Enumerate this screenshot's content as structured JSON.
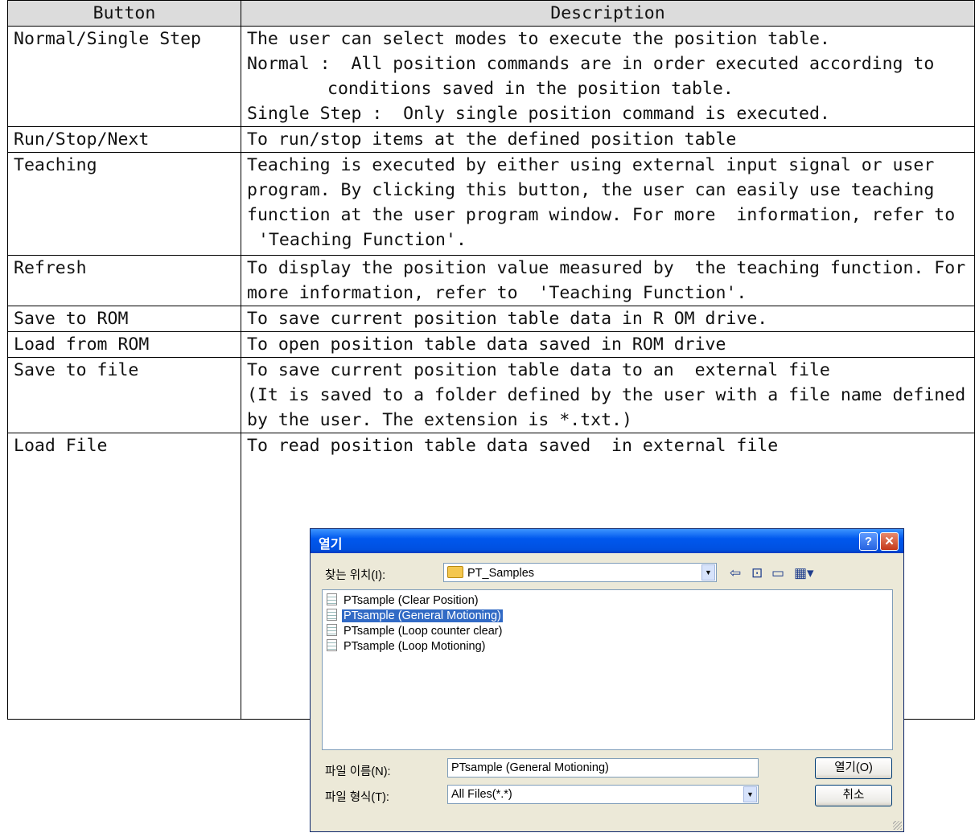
{
  "table": {
    "headers": [
      "Button",
      "Description"
    ],
    "rows": [
      {
        "button": "Normal/Single Step",
        "lines": [
          "The user can select modes to execute the position table.",
          "Normal :  All position commands are in order executed according to",
          "conditions saved in the position table.",
          "Single Step :  Only single position command is executed."
        ]
      },
      {
        "button": "Run/Stop/Next",
        "lines": [
          "To run/stop items at the defined position table"
        ]
      },
      {
        "button": "Teaching",
        "lines": [
          "Teaching is executed by either using external input signal or user",
          "program. By clicking this button, the user can easily use teaching",
          "function at the user program window. For more  information, refer to",
          "'Teaching Function'."
        ]
      },
      {
        "button": "Refresh",
        "lines": [
          "To display the position value measured by  the teaching function. For",
          "more information, refer to  'Teaching Function'."
        ]
      },
      {
        "button": "Save to ROM",
        "lines": [
          "To save current position table data in R OM drive."
        ]
      },
      {
        "button": "Load from ROM",
        "lines": [
          "To open position table data saved in ROM drive"
        ]
      },
      {
        "button": "Save to file",
        "lines": [
          "To save current position table data to an  external file",
          "(It is saved to a folder defined by the user with a file name defined",
          "by the user. The extension is *.txt.)"
        ]
      },
      {
        "button": "Load File",
        "lines": [
          "To read position table data saved  in external file"
        ]
      }
    ]
  },
  "dialog": {
    "title": "열기",
    "help_glyph": "?",
    "close_glyph": "✕",
    "look_in_label": "찾는 위치(I):",
    "look_in_value": "PT_Samples",
    "files": [
      "PTsample (Clear Position)",
      "PTsample (General Motioning)",
      "PTsample (Loop counter clear)",
      "PTsample (Loop Motioning)"
    ],
    "selected_file_index": 1,
    "filename_label": "파일 이름(N):",
    "filename_value": "PTsample (General Motioning)",
    "filetype_label": "파일 형식(T):",
    "filetype_value": "All Files(*.*)",
    "open_button": "열기(O)",
    "cancel_button": "취소"
  }
}
